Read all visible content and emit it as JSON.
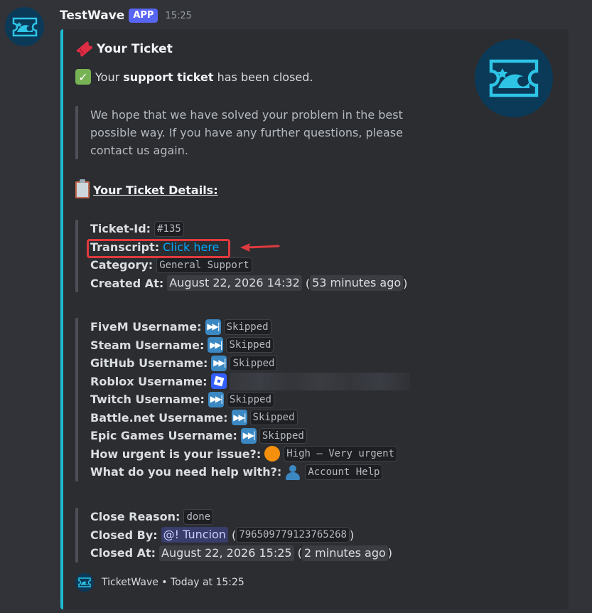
{
  "message": {
    "username": "TestWave",
    "app_tag": "APP",
    "time": "15:25"
  },
  "embed": {
    "title": "Your Ticket",
    "closed_line": {
      "prefix": "Your",
      "bold": "support ticket",
      "suffix": "has been closed."
    },
    "quote_text": "We hope that we have solved your problem in the best possible way. If you have any further questions, please contact us again.",
    "details_title": "Your Ticket Details:",
    "ticket": {
      "id_label": "Ticket-Id:",
      "id_value": "#135",
      "transcript_label": "Transcript:",
      "transcript_link": "Click here",
      "category_label": "Category:",
      "category_value": "General Support",
      "created_label": "Created At:",
      "created_value": "August 22, 2026 14:32",
      "created_relative": "53 minutes ago"
    },
    "answers": [
      {
        "label": "FiveM Username:",
        "emoji": "skip-icon",
        "value": "Skipped"
      },
      {
        "label": "Steam Username:",
        "emoji": "skip-icon",
        "value": "Skipped"
      },
      {
        "label": "GitHub Username:",
        "emoji": "skip-icon",
        "value": "Skipped"
      },
      {
        "label": "Roblox Username:",
        "emoji": "roblox-icon",
        "value": ""
      },
      {
        "label": "Twitch Username:",
        "emoji": "skip-icon",
        "value": "Skipped"
      },
      {
        "label": "Battle.net Username:",
        "emoji": "skip-icon",
        "value": "Skipped"
      },
      {
        "label": "Epic Games Username:",
        "emoji": "skip-icon",
        "value": "Skipped"
      },
      {
        "label": "How urgent is your issue?:",
        "emoji": "orange-circle-icon",
        "value": "High – Very urgent"
      },
      {
        "label": "What do you need help with?:",
        "emoji": "person-icon",
        "value": "Account Help"
      }
    ],
    "close": {
      "reason_label": "Close Reason:",
      "reason_value": "done",
      "by_label": "Closed By:",
      "by_mention": "@! Tuncion",
      "by_id": "796509779123765268",
      "at_label": "Closed At:",
      "at_value": "August 22, 2026 15:25",
      "at_relative": "2 minutes ago"
    },
    "footer": "TicketWave • Today at 15:25",
    "accent_color": "#1dbbd3"
  }
}
